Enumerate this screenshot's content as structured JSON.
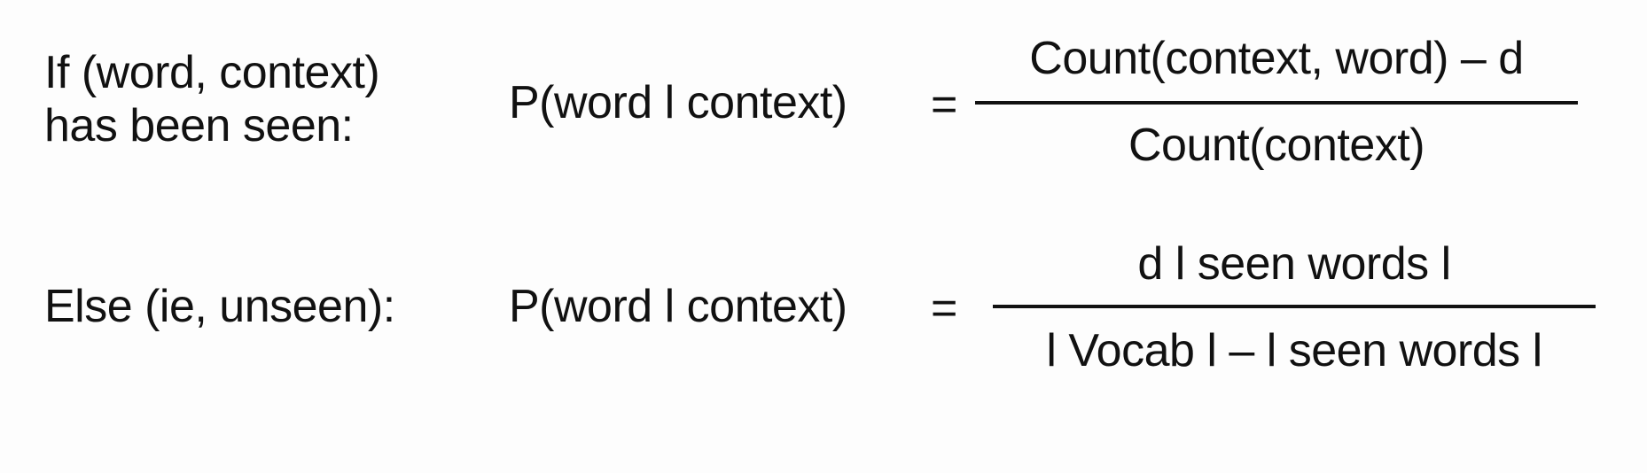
{
  "rule_seen": {
    "condition_line1": "If (word, context)",
    "condition_line2": "has been seen:",
    "lhs": "P(word l context)",
    "equals": "=",
    "numerator": "Count(context, word) – d",
    "denominator": "Count(context)"
  },
  "rule_unseen": {
    "condition": "Else (ie, unseen):",
    "lhs": "P(word l context)",
    "equals": "=",
    "numerator": "d l seen words l",
    "denominator": "l Vocab l – l seen words l"
  }
}
